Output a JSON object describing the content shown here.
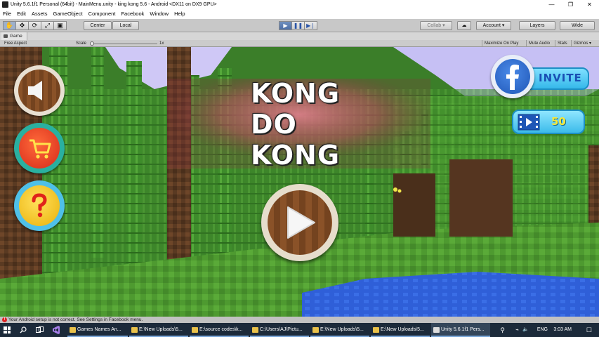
{
  "window": {
    "title": "Unity 5.6.1f1 Personal (64bit) - MainMenu.unity - king kong 5.6 - Android <DX11 on DX9 GPU>",
    "controls": [
      "—",
      "❐",
      "✕"
    ]
  },
  "menu": [
    "File",
    "Edit",
    "Assets",
    "GameObject",
    "Component",
    "Facebook",
    "Window",
    "Help"
  ],
  "toolbar": {
    "tools": [
      "✋",
      "✥",
      "⟳",
      "⤢",
      "▣"
    ],
    "pivot": "Center",
    "space": "Local",
    "play": [
      "▶",
      "❚❚",
      "▶❘"
    ],
    "collab": "Collab ▾",
    "cloud": "☁",
    "account": "Account ▾",
    "layers": "Layers",
    "layout": "Wide"
  },
  "game_panel": {
    "tab": "Game",
    "aspect": "Free Aspect",
    "scale_label": "Scale",
    "scale_value": "1x",
    "options": [
      "Maximize On Play",
      "Mute Audio",
      "Stats",
      "Gizmos ▾"
    ]
  },
  "game": {
    "logo_lines": [
      "KONG",
      "DO",
      "KONG"
    ],
    "invite_label": "INVITE",
    "video_reward": "50",
    "colors": {
      "wood": "#7a4a22",
      "red_button": "#e23a2a",
      "yellow_button": "#f2c21f",
      "blue_button": "#2f80d6",
      "invite_pill": "#45c9f0"
    }
  },
  "status": {
    "message": "Your Android setup is not correct. See Settings in Facebook menu."
  },
  "taskbar": {
    "items": [
      "Games Names An...",
      "E:\\New Uploads\\5...",
      "E:\\source codes\\k...",
      "C:\\Users\\AJ\\Pictu...",
      "E:\\New Uploads\\5...",
      "E:\\New Uploads\\5...",
      "Unity 5.6.1f1 Pers..."
    ],
    "language": "ENG",
    "time": "3:03 AM"
  }
}
